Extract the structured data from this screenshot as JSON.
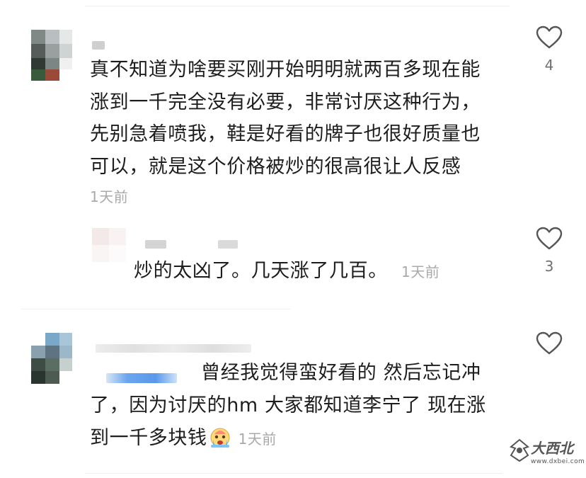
{
  "comments": [
    {
      "text_lines": [
        "真不知道为啥要买刚开始明明就两百多现在能",
        "涨到一千完全没有必要，非常讨厌这种行为，",
        "先别急着喷我，鞋是好看的牌子也很好质量也",
        "可以，就是这个价格被炒的很高很让人反感"
      ],
      "time": "1天前",
      "like_count": "4",
      "reply": {
        "text": "炒的太凶了。几天涨了几百。",
        "time": "1天前",
        "like_count": "3"
      }
    },
    {
      "text_lines": [
        "曾经我觉得蛮好看的 然后忘记冲",
        "了，因为讨厌的hm 大家都知道李宁了 现在涨",
        "到一千多块钱"
      ],
      "time": "1天前",
      "emoji": "crying-face-emoji"
    }
  ],
  "watermark": {
    "text": "大西北",
    "url": "www.dxbei.com"
  },
  "colors": {
    "text": "#1d1d1d",
    "time": "#a9a9a9",
    "count": "#6f6f6f",
    "icon_stroke": "#555555"
  },
  "icons": [
    "heart-outline-icon",
    "crying-face-emoji",
    "watermark-logo-icon"
  ]
}
